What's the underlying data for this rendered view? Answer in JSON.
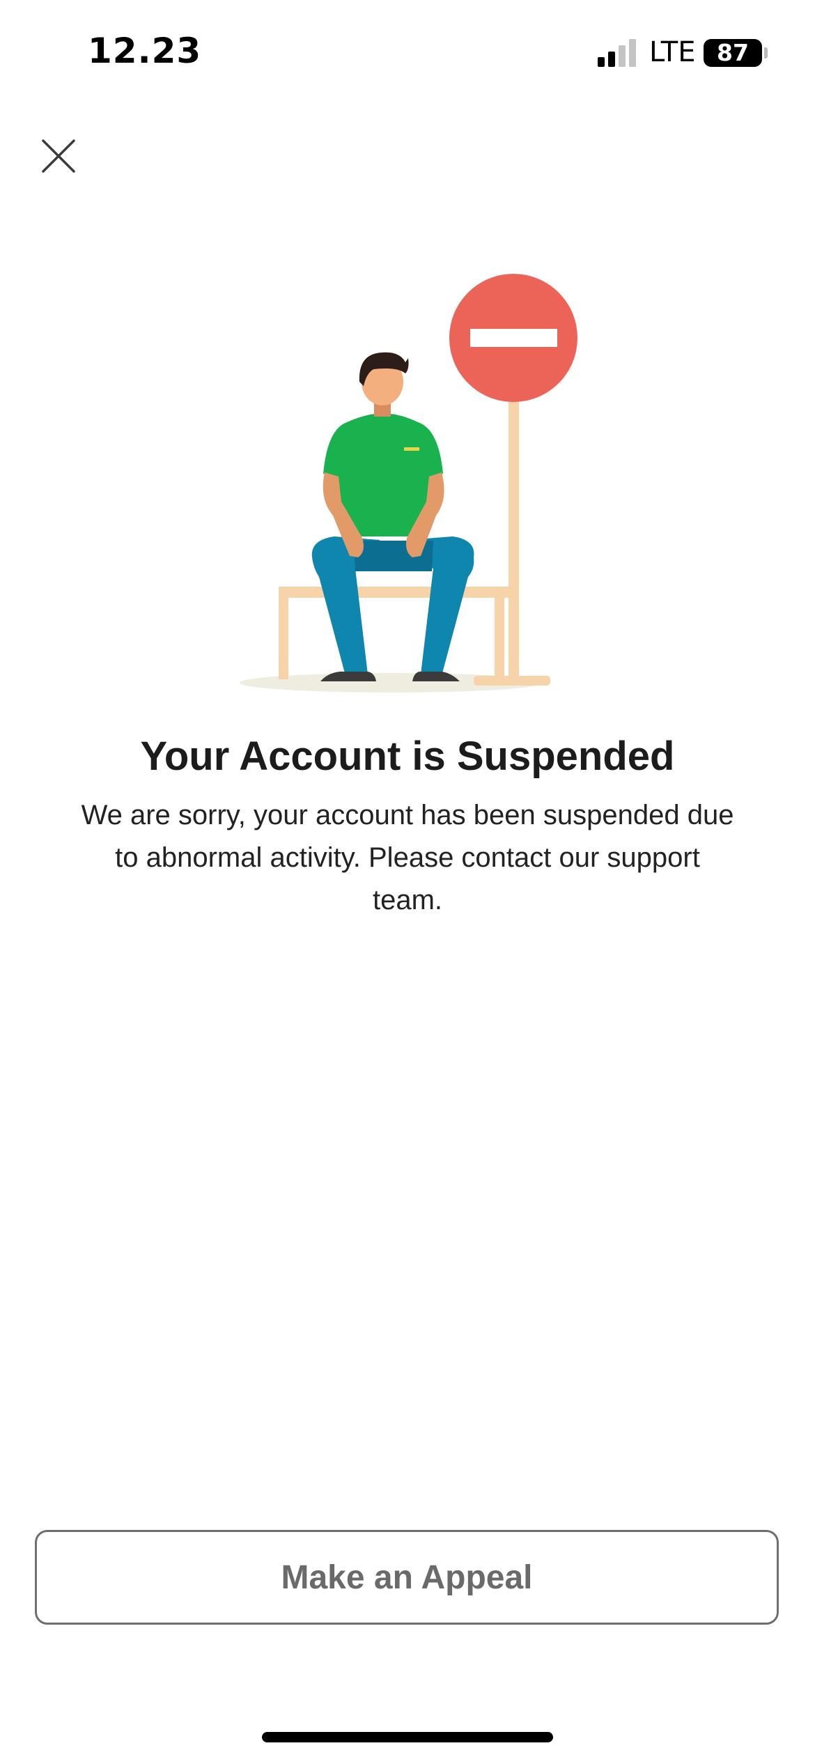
{
  "status_bar": {
    "time": "12.23",
    "network": "LTE",
    "battery": "87"
  },
  "icons": {
    "close": "close-icon",
    "signal": "signal-icon",
    "battery": "battery-icon"
  },
  "colors": {
    "sign_red": "#ec6457",
    "shirt_green": "#1ab14f",
    "pants_blue": "#0f86ae",
    "bench_tan": "#f6d3a9",
    "button_border": "#6e6e6e"
  },
  "main": {
    "title": "Your Account is Suspended",
    "message": "We are sorry, your account has been suspended due to abnormal activity. Please contact our support team."
  },
  "actions": {
    "appeal_label": "Make an Appeal"
  }
}
